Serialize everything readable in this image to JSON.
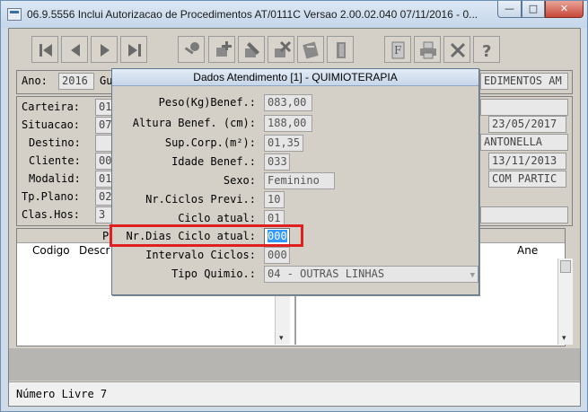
{
  "window": {
    "title": "06.9.5556   Inclui  Autorizacao de Procedimentos AT/0111C Versao 2.00.02.040 07/11/2016 - 0...",
    "min_glyph": "—",
    "max_glyph": "□",
    "close_glyph": "✕"
  },
  "toolbar": {
    "buttons": [
      "first-record",
      "previous-record",
      "next-record",
      "last-record",
      "search",
      "add",
      "edit",
      "delete",
      "document",
      "exit",
      "report",
      "print",
      "tools",
      "help"
    ]
  },
  "form": {
    "ano_label": "Ano:",
    "ano_value": "2016",
    "gu_label": "Gu",
    "right_header_value": "EDIMENTOS AM",
    "carteira_label": "Carteira:",
    "carteira_value": "01",
    "situacao_label": "Situacao:",
    "situacao_value": "07",
    "destino_label": "Destino:",
    "cliente_label": "Cliente:",
    "cliente_value": "00",
    "modalid_label": "Modalid:",
    "modalid_value": "01",
    "tpplano_label": "Tp.Plano:",
    "tpplano_value": "02",
    "claShos_label": "Clas.Hos:",
    "clashos_value": "3",
    "date1": "23/05/2017",
    "name": "ANTONELLA",
    "date2": "13/11/2013",
    "com_partic": "COM PARTIC"
  },
  "grid": {
    "left_letter": "P",
    "col_codigo": "Codigo",
    "col_descr": "Descr",
    "col_ane": "Ane",
    "scroll_down": "▾"
  },
  "status": {
    "text": "Número Livre 7"
  },
  "dialog": {
    "title": "Dados Atendimento [1] - QUIMIOTERAPIA",
    "fields": [
      {
        "label": "Peso(Kg)Benef.:",
        "value": "083,00"
      },
      {
        "label": "Altura Benef. (cm):",
        "value": "188,00"
      },
      {
        "label": "Sup.Corp.(m²):",
        "value": "01,35"
      },
      {
        "label": "Idade Benef.:",
        "value": "033"
      },
      {
        "label": "Sexo:",
        "value": "Feminino"
      },
      {
        "label": "Nr.Ciclos Previ.:",
        "value": "10"
      },
      {
        "label": "Ciclo atual:",
        "value": "01"
      },
      {
        "label": "Nr.Dias Ciclo atual:",
        "value": "000"
      },
      {
        "label": "Intervalo Ciclos:",
        "value": "000"
      },
      {
        "label": "Tipo Quimio.:",
        "value": "04 - OUTRAS LINHAS"
      }
    ],
    "combo_arrow": "▼"
  }
}
